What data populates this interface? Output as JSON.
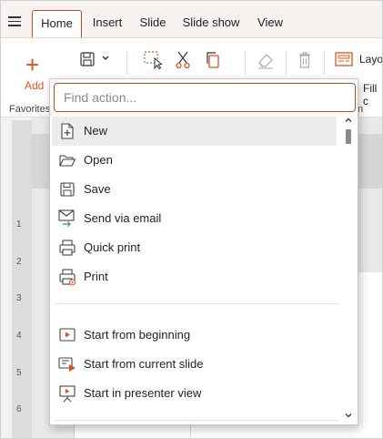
{
  "tabs": [
    {
      "label": "Home",
      "active": true
    },
    {
      "label": "Insert",
      "active": false
    },
    {
      "label": "Slide",
      "active": false
    },
    {
      "label": "Slide show",
      "active": false
    },
    {
      "label": "View",
      "active": false
    }
  ],
  "ribbon": {
    "add_label": "Add",
    "favorites_label": "Favorites",
    "layout_label": "Layo",
    "fill_label": "Fill c",
    "partial_group_label": "n"
  },
  "ruler": [
    "1",
    "2",
    "3",
    "4",
    "5",
    "6"
  ],
  "search": {
    "placeholder": "Find action...",
    "value": ""
  },
  "menu": {
    "group1": [
      {
        "label": "New",
        "icon": "new-document-icon",
        "highlighted": true
      },
      {
        "label": "Open",
        "icon": "open-folder-icon"
      },
      {
        "label": "Save",
        "icon": "save-icon"
      },
      {
        "label": "Send via email",
        "icon": "email-icon"
      },
      {
        "label": "Quick print",
        "icon": "quick-print-icon"
      },
      {
        "label": "Print",
        "icon": "print-icon"
      }
    ],
    "group2": [
      {
        "label": "Start from beginning",
        "icon": "play-icon"
      },
      {
        "label": "Start from current slide",
        "icon": "play-current-slide-icon"
      },
      {
        "label": "Start in presenter view",
        "icon": "presenter-view-icon"
      }
    ]
  },
  "colors": {
    "accent": "#d9541e",
    "accent_border": "#c64a1e",
    "highlight": "#ececec",
    "email_arrow": "#2a9d6a"
  }
}
